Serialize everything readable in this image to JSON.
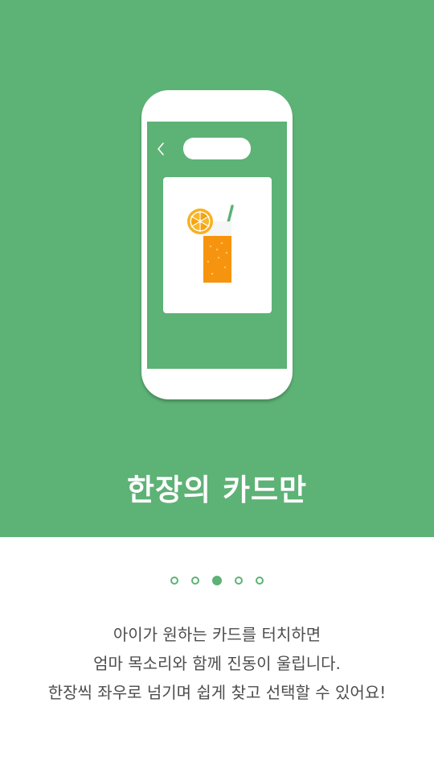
{
  "colors": {
    "brand_green": "#5db276",
    "juice_orange": "#f7940f",
    "text_gray": "#4d4d4d"
  },
  "hero": {
    "title": "한장의 카드만",
    "illustration": {
      "icons": [
        "chevron-left-icon",
        "juice-glass-icon",
        "orange-slice-icon"
      ]
    }
  },
  "pager": {
    "total": 5,
    "active_index": 3
  },
  "description": {
    "lines": [
      "아이가 원하는 카드를 터치하면",
      "엄마 목소리와 함께 진동이 울립니다.",
      "한장씩 좌우로 넘기며 쉽게 찾고 선택할 수 있어요!"
    ]
  }
}
